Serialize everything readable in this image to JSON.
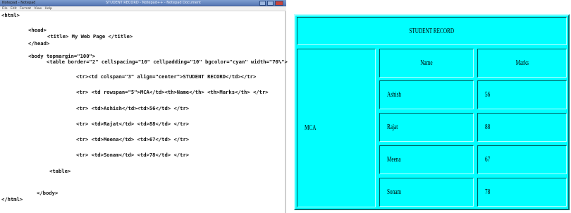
{
  "editor": {
    "title_app": "Notepad - Notepad",
    "title_doc": "STUDENT RECORD - Notepad++ - Notepad Document",
    "menu": [
      "File",
      "Edit",
      "Format",
      "View",
      "Help"
    ],
    "code_lines": [
      "<html>",
      "<head>",
      "<title> My Web Page </title>",
      "</head>",
      "<body topmargin=\"100\">",
      "<table border=\"2\" cellspacing=\"10\" cellpadding=\"10\" bgcolor=\"cyan\" width=\"70%\">",
      "<tr><td colspan=\"3\" align=\"center\">STUDENT RECORD</td></tr>",
      "<tr> <td rowspan=\"5\">MCA</td><th>Name</th> <th>Marks</th> </tr>",
      "<tr> <td>Ashish</td><td>56</td> </tr>",
      "<tr> <td>Rajat</td> <td>88</td> </tr>",
      "<tr> <td>Meena</td> <td>67</td> </tr>",
      "<tr> <td>Sonam</td> <td>78</td> </tr>",
      "<table>",
      "</body>",
      "</html>"
    ]
  },
  "browser": {
    "table": {
      "caption": "STUDENT RECORD",
      "course": "MCA",
      "headers": {
        "name": "Name",
        "marks": "Marks"
      },
      "rows": [
        {
          "name": "Ashish",
          "marks": "56"
        },
        {
          "name": "Rajat",
          "marks": "88"
        },
        {
          "name": "Meena",
          "marks": "67"
        },
        {
          "name": "Sonam",
          "marks": "78"
        }
      ],
      "bgcolor": "#00ffff"
    }
  }
}
